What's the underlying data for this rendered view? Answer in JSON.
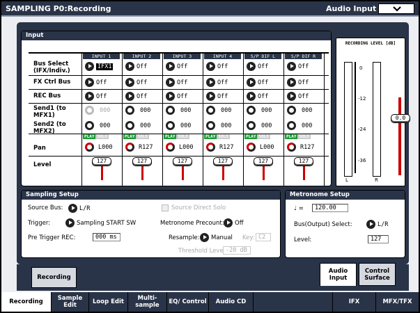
{
  "header": {
    "title": "SAMPLING P0:Recording",
    "page_select": "Audio Input"
  },
  "input": {
    "title": "Input",
    "columns": [
      "INPUT 1",
      "INPUT 2",
      "INPUT 3",
      "INPUT 4",
      "S/P DIF L",
      "S/P DIF R"
    ],
    "row_labels": {
      "bus_select": "Bus Select (IFX/Indiv.)",
      "fx_ctrl": "FX Ctrl Bus",
      "rec_bus": "REC Bus",
      "send1": "Send1 (to MFX1)",
      "send2": "Send2 (to MFX2)",
      "pan": "Pan",
      "level": "Level"
    },
    "bus_select": [
      "IFX1",
      "Off",
      "Off",
      "Off",
      "Off",
      "Off"
    ],
    "fx_ctrl": [
      "Off",
      "Off",
      "Off",
      "Off",
      "Off",
      "Off"
    ],
    "rec_bus": [
      "Off",
      "Off",
      "Off",
      "Off",
      "Off",
      "Off"
    ],
    "send1": [
      "000",
      "000",
      "000",
      "000",
      "000",
      "000"
    ],
    "send2": [
      "000",
      "000",
      "000",
      "000",
      "000",
      "000"
    ],
    "play_label": "PLAY",
    "solo_label": "SOLO",
    "pan": [
      "L000",
      "R127",
      "L000",
      "R127",
      "L000",
      "R127"
    ],
    "level": [
      "127",
      "127",
      "127",
      "127",
      "127",
      "127"
    ]
  },
  "recording_level": {
    "title": "RECORDING LEVEL [dB]",
    "ticks": [
      "0",
      "-12",
      "-24",
      "-36"
    ],
    "left": "L",
    "right": "R",
    "fader_value": "0.0"
  },
  "sampling_setup": {
    "title": "Sampling Setup",
    "source_bus_label": "Source Bus:",
    "source_bus": "L/R",
    "source_direct_solo": "Source Direct Solo",
    "trigger_label": "Trigger:",
    "trigger": "Sampling START SW",
    "metronome_precount_label": "Metronome Precount:",
    "metronome_precount": "Off",
    "pre_trigger_label": "Pre Trigger REC:",
    "pre_trigger": "000 ms",
    "resample_label": "Resample:",
    "resample": "Manual",
    "key_label": "Key:",
    "key": "C2",
    "threshold_label": "Threshold Level:",
    "threshold": "-20 dB"
  },
  "metronome_setup": {
    "title": "Metronome Setup",
    "tempo_symbol": "♩ =",
    "tempo": "120.00",
    "bus_label": "Bus(Output) Select:",
    "bus": "L/R",
    "level_label": "Level:",
    "level": "127"
  },
  "tabs": {
    "recording": "Recording",
    "audio_input": "Audio Input",
    "control_surface": "Control Surface"
  },
  "bottom_tabs": [
    "Recording",
    "Sample Edit",
    "Loop Edit",
    "Multi-sample",
    "EQ/ Control",
    "Audio CD",
    "IFX",
    "MFX/TFX"
  ]
}
